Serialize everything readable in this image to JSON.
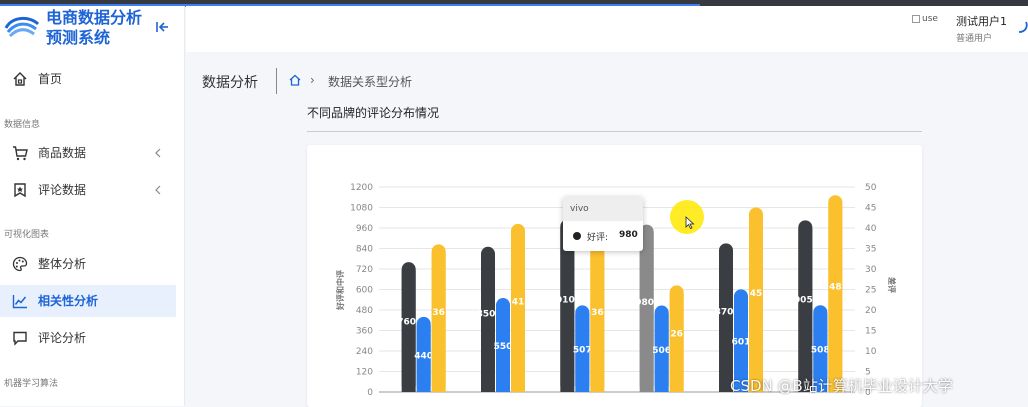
{
  "app": {
    "title": "电商数据分析预测系统",
    "title_line1": "电商数据分析",
    "title_line2": "预测系统"
  },
  "colors": {
    "brand": "#1e64d6",
    "good_reviews": "#3a3d42",
    "mid_reviews": "#2b7ff0",
    "bad_reviews": "#fbc02d",
    "active_bg": "#e8f0fe"
  },
  "sidebar": {
    "items": [
      {
        "label": "首页",
        "icon": "home-icon"
      },
      {
        "group": "数据信息"
      },
      {
        "label": "商品数据",
        "icon": "cart-icon",
        "chevron": true
      },
      {
        "label": "评论数据",
        "icon": "bookmark-icon",
        "chevron": true
      },
      {
        "group": "可视化图表"
      },
      {
        "label": "整体分析",
        "icon": "palette-icon"
      },
      {
        "label": "相关性分析",
        "icon": "line-chart-icon",
        "active": true
      },
      {
        "label": "评论分析",
        "icon": "comment-icon"
      },
      {
        "group": "机器学习算法"
      }
    ]
  },
  "header": {
    "avatar_alt": "use",
    "user_name": "测试用户1",
    "user_role": "普通用户"
  },
  "page": {
    "title": "数据分析",
    "breadcrumb_current": "数据关系型分析",
    "section_title": "不同品牌的评论分布情况"
  },
  "chart_data": {
    "type": "bar",
    "title": "",
    "categories": [
      "",
      "",
      "",
      "",
      "",
      ""
    ],
    "series": [
      {
        "name": "好评",
        "axis": "left",
        "values": [
          760,
          850,
          1010,
          980,
          870,
          1005
        ]
      },
      {
        "name": "",
        "axis": "left",
        "values": [
          440,
          550,
          507,
          506,
          601,
          508
        ]
      },
      {
        "name": "",
        "axis": "right",
        "values": [
          36,
          41,
          36,
          26,
          45,
          48
        ]
      }
    ],
    "value_labels": [
      [
        "760",
        "850",
        "010",
        "980",
        "870",
        "005"
      ],
      [
        "440",
        "550",
        "507",
        "506",
        "601",
        "508"
      ],
      [
        "36",
        "41",
        "36",
        "26",
        "45",
        "48"
      ]
    ],
    "y_left": {
      "label": "好评和中评",
      "ticks": [
        0,
        120,
        240,
        360,
        480,
        600,
        720,
        840,
        960,
        1080,
        1200
      ],
      "ylim": [
        0,
        1200
      ]
    },
    "y_right": {
      "label": "差评",
      "ticks": [
        0,
        5,
        10,
        15,
        20,
        25,
        30,
        35,
        40,
        45,
        50
      ],
      "ylim": [
        0,
        50
      ]
    },
    "highlighted_category_index": 3,
    "grid": true
  },
  "tooltip": {
    "title": "vivo",
    "series": "好评",
    "value": "980"
  },
  "watermark": "CSDN @B站计算机毕业设计大学"
}
